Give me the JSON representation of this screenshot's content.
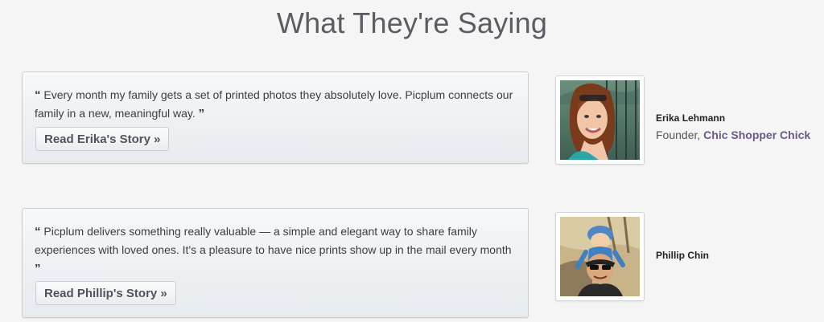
{
  "section": {
    "title": "What They're Saying"
  },
  "testimonials": [
    {
      "open_quote": "“",
      "close_quote": "”",
      "quote": "Every month my family gets a set of printed photos they absolutely love. Picplum connects our family in a new, meaningful way.",
      "button_label": "Read Erika's Story »",
      "person_name": "Erika Lehmann",
      "person_role_prefix": "Founder, ",
      "person_company": "Chic Shopper Chick"
    },
    {
      "open_quote": "“",
      "close_quote": "”",
      "quote": "Picplum delivers something really valuable — a simple and elegant way to share family experiences with loved ones. It's a pleasure to have nice prints show up in the mail every month",
      "button_label": "Read Phillip's Story »",
      "person_name": "Phillip Chin"
    }
  ],
  "colors": {
    "title": "#5a5d63",
    "link": "#6a5a8a",
    "card_border": "#c8ced3"
  }
}
